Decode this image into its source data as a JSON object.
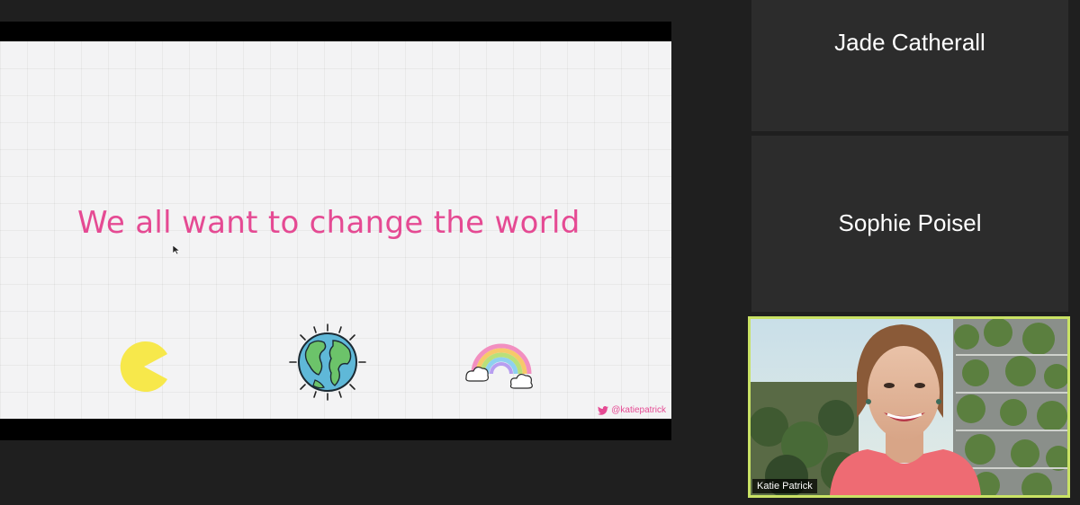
{
  "slide": {
    "title": "We all want to change the world",
    "handle": "@katiepatrick",
    "icons": [
      "pacman-icon",
      "globe-icon",
      "rainbow-icon",
      "twitter-icon"
    ],
    "title_color": "#e54a93"
  },
  "participants": [
    {
      "name": "Jade Catherall",
      "video": false
    },
    {
      "name": "Sophie Poisel",
      "video": false
    },
    {
      "name": "Katie Patrick",
      "video": true,
      "active_speaker": true
    }
  ],
  "colors": {
    "background": "#1f1f1f",
    "tile": "#2c2c2c",
    "active_border": "#c9e265",
    "accent_pink": "#e54a93"
  }
}
